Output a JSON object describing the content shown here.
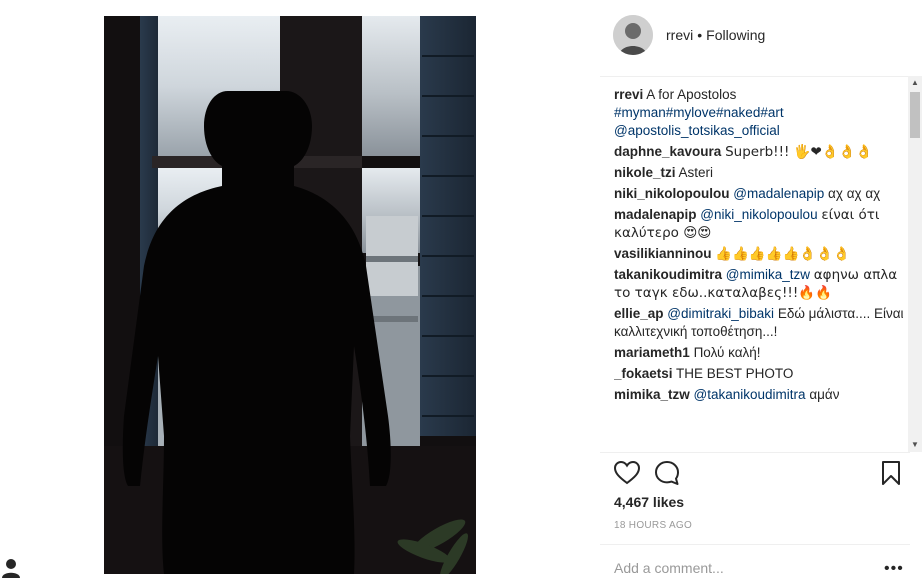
{
  "header": {
    "username": "rrevi",
    "separator": "•",
    "follow_status": "Following"
  },
  "caption": {
    "author": "rrevi",
    "text": "A for Apostolos",
    "hashtags": "#myman#mylove#naked#art",
    "mention": "@apostolis_totsikas_official"
  },
  "comments": [
    {
      "author": "daphne_kavoura",
      "mention": "",
      "text": "Superb!!! 🖐❤👌👌👌"
    },
    {
      "author": "nikole_tzi",
      "mention": "",
      "text": "Asteri"
    },
    {
      "author": "niki_nikolopoulou",
      "mention": "@madalenapip",
      "text": "αχ αχ αχ"
    },
    {
      "author": "madalenapip",
      "mention": "@niki_nikolopoulou",
      "text": "είναι ότι καλύτερο 😍😍"
    },
    {
      "author": "vasilikianninou",
      "mention": "",
      "text": "👍👍👍👍👍👌👌👌"
    },
    {
      "author": "takanikoudimitra",
      "mention": "@mimika_tzw",
      "text": "αφηνω απλα το ταγκ εδω..καταλαβες!!!🔥🔥"
    },
    {
      "author": "ellie_ap",
      "mention": "@dimitraki_bibaki",
      "text": "Εδώ μάλιστα.... Είναι καλλιτεχνική τοποθέτηση...!"
    },
    {
      "author": "mariameth1",
      "mention": "",
      "text": "Πολύ καλή!"
    },
    {
      "author": "_fokaetsi",
      "mention": "",
      "text": "THE BEST PHOTO"
    },
    {
      "author": "mimika_tzw",
      "mention": "@takanikoudimitra",
      "text": "αμάν"
    }
  ],
  "likes": "4,467 likes",
  "timestamp": "18 HOURS AGO",
  "add_comment_placeholder": "Add a comment...",
  "more_label": "•••",
  "icons": {
    "like": "heart-icon",
    "comment": "comment-icon",
    "save": "bookmark-icon",
    "scroll_up": "scroll-up-arrow-icon",
    "scroll_down": "scroll-down-arrow-icon"
  },
  "colors": {
    "link": "#003569",
    "text": "#262626",
    "muted": "#999999"
  }
}
